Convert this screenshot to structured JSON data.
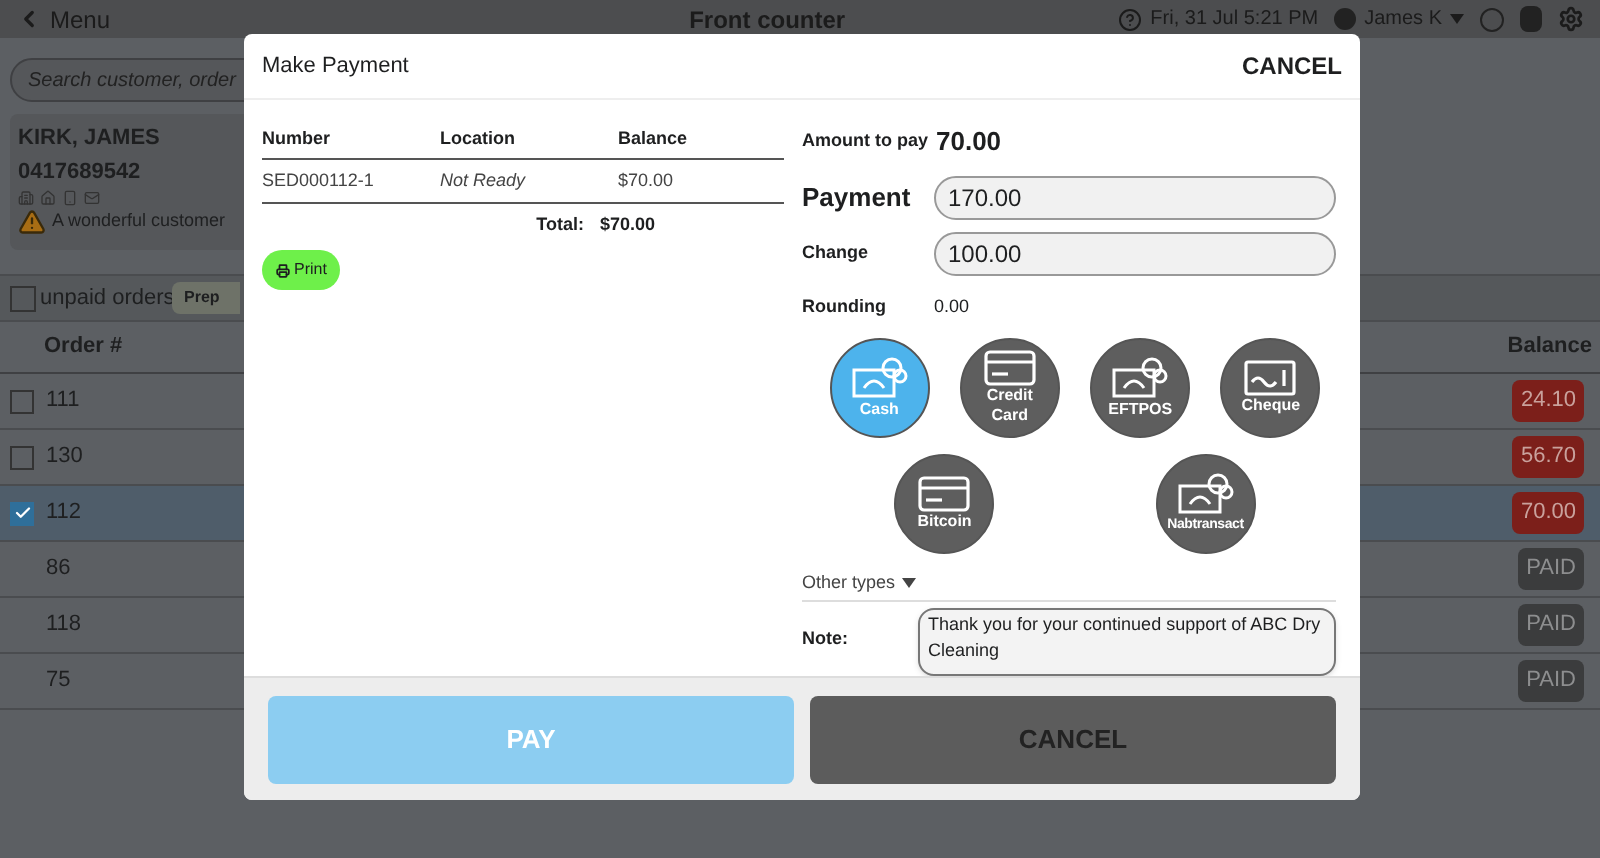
{
  "top_bar": {
    "menu": "Menu",
    "title": "Front counter",
    "datetime": "Fri, 31 Jul 5:21 PM",
    "user": "James K"
  },
  "search": {
    "placeholder": "Search customer, order"
  },
  "customer": {
    "name": "KIRK, JAMES",
    "phone": "0417689542",
    "note": "A wonderful customer"
  },
  "filters": {
    "unpaid_orders": {
      "label": "unpaid orders",
      "checked": false
    },
    "prep_tab": "Prep"
  },
  "orders": {
    "columns": [
      "Order #",
      "Balance"
    ],
    "rows": [
      {
        "order": "111",
        "balance": "24.10",
        "kind": "due",
        "checked": false
      },
      {
        "order": "130",
        "balance": "56.70",
        "kind": "due",
        "checked": false
      },
      {
        "order": "112",
        "balance": "70.00",
        "kind": "due",
        "checked": true
      },
      {
        "order": "86",
        "balance": "PAID",
        "kind": "paid"
      },
      {
        "order": "118",
        "balance": "PAID",
        "kind": "paid"
      },
      {
        "order": "75",
        "balance": "PAID",
        "kind": "paid"
      }
    ]
  },
  "dialog": {
    "title": "Make Payment",
    "cancel_link": "CANCEL",
    "table": {
      "columns": [
        "Number",
        "Location",
        "Balance"
      ],
      "rows": [
        {
          "number": "SED000112-1",
          "location": "Not Ready",
          "balance": "$70.00"
        }
      ],
      "total_label": "Total:",
      "total": "$70.00"
    },
    "print_button": "Print",
    "amount_label": "Amount to pay",
    "amount": "70.00",
    "payment_label": "Payment",
    "payment": "170.00",
    "change_label": "Change",
    "change": "100.00",
    "rounding_label": "Rounding",
    "rounding": "0.00",
    "methods": [
      {
        "label": "Cash",
        "kind": "cash",
        "selected": true
      },
      {
        "label": "Credit Card",
        "kind": "card",
        "selected": false
      },
      {
        "label": "EFTPOS",
        "kind": "cash",
        "selected": false
      },
      {
        "label": "Cheque",
        "kind": "cheque",
        "selected": false
      },
      {
        "label": "Bitcoin",
        "kind": "card",
        "selected": false
      },
      {
        "label": "Nabtransact",
        "kind": "cash",
        "selected": false
      }
    ],
    "other_types": "Other types",
    "note_label": "Note:",
    "note": "Thank you for your continued support of ABC Dry Cleaning",
    "pay_button": {
      "label": "PAY",
      "disabled": true
    },
    "cancel_button": "CANCEL"
  }
}
